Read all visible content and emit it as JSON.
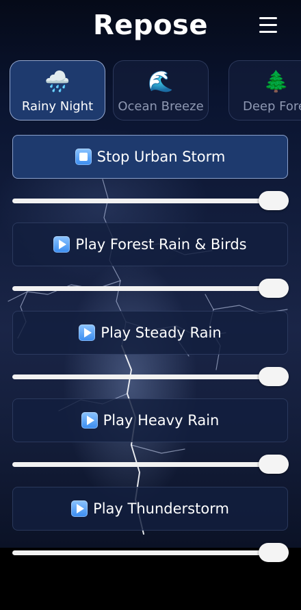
{
  "app": {
    "title": "Repose"
  },
  "icons": {
    "menu": "hamburger-menu-icon",
    "play": "play-icon",
    "stop": "stop-icon"
  },
  "colors": {
    "active_background": "#1e3a6e",
    "card_background": "#121e3e",
    "text": "#ffffff"
  },
  "tabs": [
    {
      "emoji": "🌧️",
      "label": "Rainy Night",
      "active": true
    },
    {
      "emoji": "🌊",
      "label": "Ocean Breeze",
      "active": false
    },
    {
      "emoji": "🌲",
      "label": "Deep Fore",
      "active": false
    }
  ],
  "sounds": [
    {
      "label": "Stop Urban Storm",
      "state": "playing",
      "volume": 1.0
    },
    {
      "label": "Play Forest Rain & Birds",
      "state": "stopped",
      "volume": 1.0
    },
    {
      "label": "Play Steady Rain",
      "state": "stopped",
      "volume": 1.0
    },
    {
      "label": "Play Heavy Rain",
      "state": "stopped",
      "volume": 1.0
    },
    {
      "label": "Play Thunderstorm",
      "state": "stopped",
      "volume": 1.0
    }
  ]
}
